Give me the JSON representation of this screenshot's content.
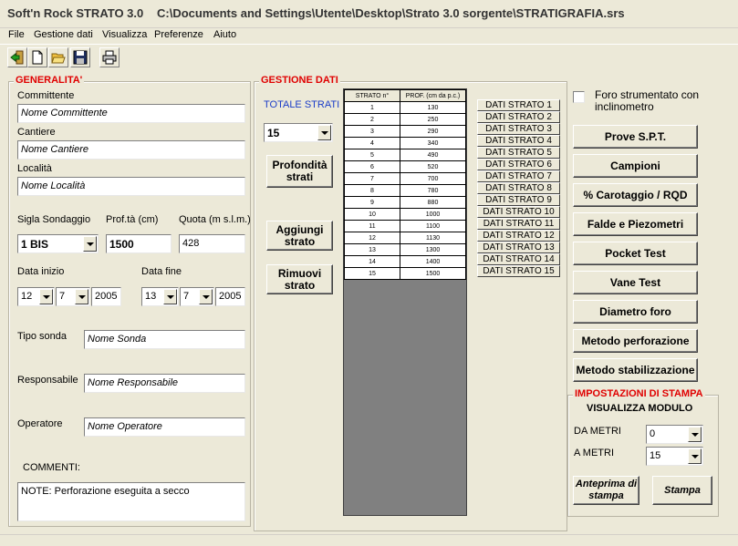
{
  "window": {
    "app_title": "Soft'n Rock STRATO 3.0",
    "file_path": "C:\\Documents and Settings\\Utente\\Desktop\\Strato 3.0 sorgente\\STRATIGRAFIA.srs"
  },
  "menu": [
    "File",
    "Gestione dati",
    "Visualizza",
    "Preferenze",
    "Aiuto"
  ],
  "toolbar": {
    "icons": [
      "exit-icon",
      "new-file-icon",
      "open-folder-icon",
      "save-icon",
      "print-icon"
    ]
  },
  "generalita": {
    "title": "GENERALITA'",
    "committente_label": "Committente",
    "committente_value": "Nome Committente",
    "cantiere_label": "Cantiere",
    "cantiere_value": "Nome Cantiere",
    "localita_label": "Località",
    "localita_value": "Nome Località",
    "sigla_label": "Sigla Sondaggio",
    "sigla_value": "1 BIS",
    "prof_label": "Prof.tà (cm)",
    "prof_value": "1500",
    "quota_label": "Quota (m s.l.m.)",
    "quota_value": "428",
    "data_inizio_label": "Data inizio",
    "data_inizio": {
      "day": "12",
      "month": "7",
      "year": "2005"
    },
    "data_fine_label": "Data fine",
    "data_fine": {
      "day": "13",
      "month": "7",
      "year": "2005"
    },
    "tipo_sonda_label": "Tipo sonda",
    "tipo_sonda_value": "Nome Sonda",
    "responsabile_label": "Responsabile",
    "responsabile_value": "Nome Responsabile",
    "operatore_label": "Operatore",
    "operatore_value": "Nome Operatore",
    "commenti_label": "COMMENTI:",
    "commenti_value": "NOTE: Perforazione eseguita a secco"
  },
  "gestione": {
    "title": "GESTIONE DATI",
    "totale_label": "TOTALE STRATI",
    "totale_value": "15",
    "profondita_button": "Profondità strati",
    "aggiungi_button": "Aggiungi strato",
    "rimuovi_button": "Rimuovi strato",
    "table_headers": [
      "STRATO n°",
      "PROF. (cm da p.c.)"
    ],
    "rows": [
      [
        "1",
        "130"
      ],
      [
        "2",
        "250"
      ],
      [
        "3",
        "290"
      ],
      [
        "4",
        "340"
      ],
      [
        "5",
        "490"
      ],
      [
        "6",
        "520"
      ],
      [
        "7",
        "700"
      ],
      [
        "8",
        "780"
      ],
      [
        "9",
        "880"
      ],
      [
        "10",
        "1000"
      ],
      [
        "11",
        "1100"
      ],
      [
        "12",
        "1130"
      ],
      [
        "13",
        "1300"
      ],
      [
        "14",
        "1400"
      ],
      [
        "15",
        "1500"
      ]
    ],
    "dati_buttons": [
      "DATI STRATO 1",
      "DATI STRATO 2",
      "DATI STRATO 3",
      "DATI STRATO 4",
      "DATI STRATO 5",
      "DATI STRATO 6",
      "DATI STRATO 7",
      "DATI STRATO 8",
      "DATI STRATO 9",
      "DATI STRATO 10",
      "DATI STRATO 11",
      "DATI STRATO 12",
      "DATI STRATO 13",
      "DATI STRATO 14",
      "DATI STRATO 15"
    ]
  },
  "right": {
    "foro_label": "Foro strumentato con inclinometro",
    "buttons": [
      "Prove S.P.T.",
      "Campioni",
      "% Carotaggio / RQD",
      "Falde e Piezometri",
      "Pocket Test",
      "Vane Test",
      "Diametro foro",
      "Metodo perforazione",
      "Metodo stabilizzazione"
    ]
  },
  "stampa": {
    "title": "IMPOSTAZIONI DI STAMPA",
    "visualizza_label": "VISUALIZZA MODULO",
    "da_label": "DA METRI",
    "da_value": "0",
    "a_label": "A METRI",
    "a_value": "15",
    "anteprima_button": "Anteprima di stampa",
    "stampa_button": "Stampa"
  }
}
